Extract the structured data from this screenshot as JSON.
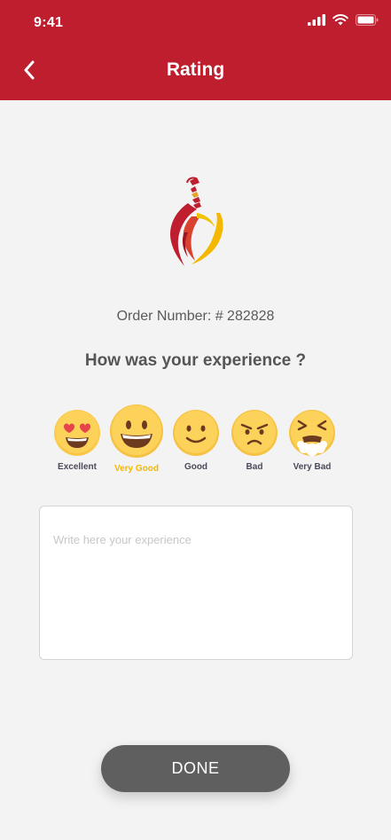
{
  "status_bar": {
    "time": "9:41"
  },
  "header": {
    "title": "Rating"
  },
  "order": {
    "text": "Order Number: # 282828"
  },
  "question": "How was your experience ?",
  "ratings": [
    {
      "label": "Excellent",
      "icon": "heart-eyes-emoji-icon"
    },
    {
      "label": "Very Good",
      "icon": "grinning-emoji-icon",
      "selected": true
    },
    {
      "label": "Good",
      "icon": "smiling-emoji-icon"
    },
    {
      "label": "Bad",
      "icon": "angry-emoji-icon"
    },
    {
      "label": "Very Bad",
      "icon": "vomiting-emoji-icon"
    }
  ],
  "feedback": {
    "placeholder": "Write here your experience",
    "value": ""
  },
  "done_label": "DONE",
  "colors": {
    "header": "#be1e2d",
    "background": "#f3f3f3",
    "selected": "#f5b800",
    "button": "#5f5f5f"
  }
}
